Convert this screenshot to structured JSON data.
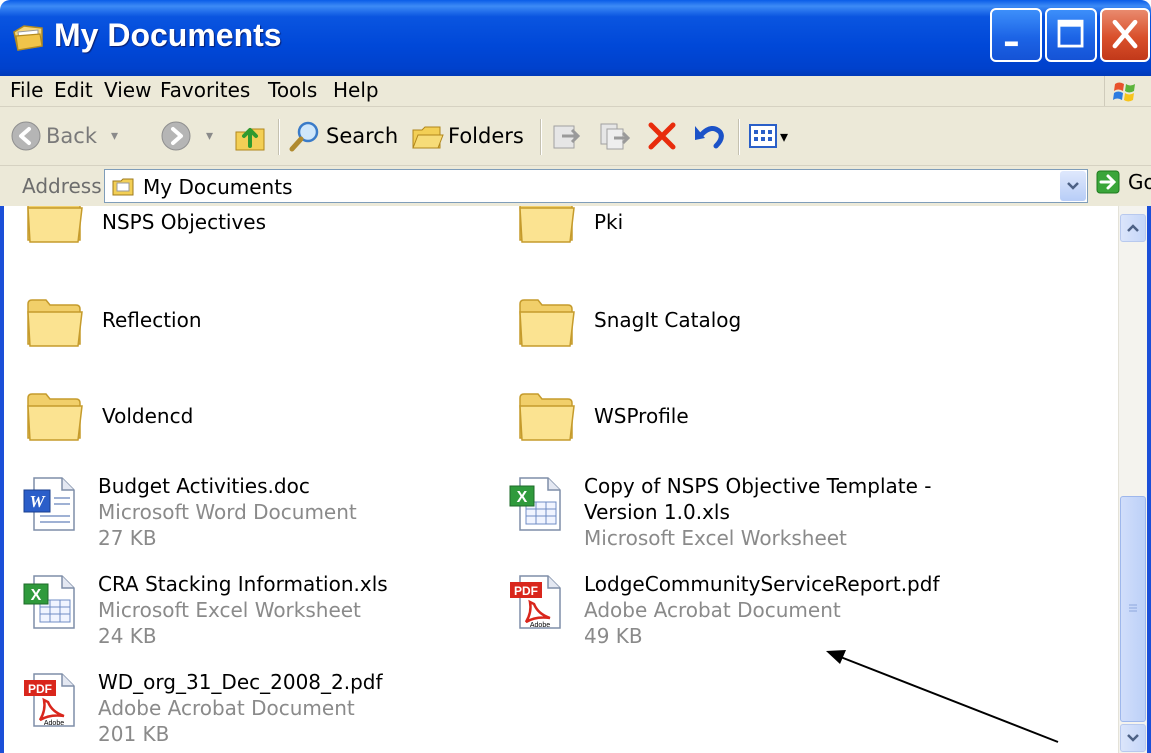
{
  "window": {
    "title": "My Documents"
  },
  "menu": [
    "File",
    "Edit",
    "View",
    "Favorites",
    "Tools",
    "Help"
  ],
  "toolbar": {
    "back_label": "Back",
    "search_label": "Search",
    "folders_label": "Folders"
  },
  "address": {
    "label": "Address",
    "value": "My Documents",
    "go_label": "Go"
  },
  "folders": [
    {
      "name": "NSPS Objectives"
    },
    {
      "name": "Pki"
    },
    {
      "name": "Reflection"
    },
    {
      "name": "SnagIt Catalog"
    },
    {
      "name": "Voldencd"
    },
    {
      "name": "WSProfile"
    }
  ],
  "files": [
    {
      "name": "Budget Activities.doc",
      "type": "Microsoft Word Document",
      "size": "27 KB",
      "icon": "word-doc-icon"
    },
    {
      "name_line1": "Copy of NSPS Objective Template -",
      "name_line2": "Version 1.0.xls",
      "type": "Microsoft Excel Worksheet",
      "icon": "excel-icon"
    },
    {
      "name": "CRA Stacking Information.xls",
      "type": "Microsoft Excel Worksheet",
      "size": "24 KB",
      "icon": "excel-icon"
    },
    {
      "name": "LodgeCommunityServiceReport.pdf",
      "type": "Adobe Acrobat Document",
      "size": "49 KB",
      "icon": "pdf-icon"
    },
    {
      "name": "WD_org_31_Dec_2008_2.pdf",
      "type": "Adobe Acrobat Document",
      "size": "201 KB",
      "icon": "pdf-icon"
    }
  ],
  "colors": {
    "titlebar": "#0048d8",
    "window_border": "#1b4fd8",
    "chrome": "#ece9d8"
  }
}
